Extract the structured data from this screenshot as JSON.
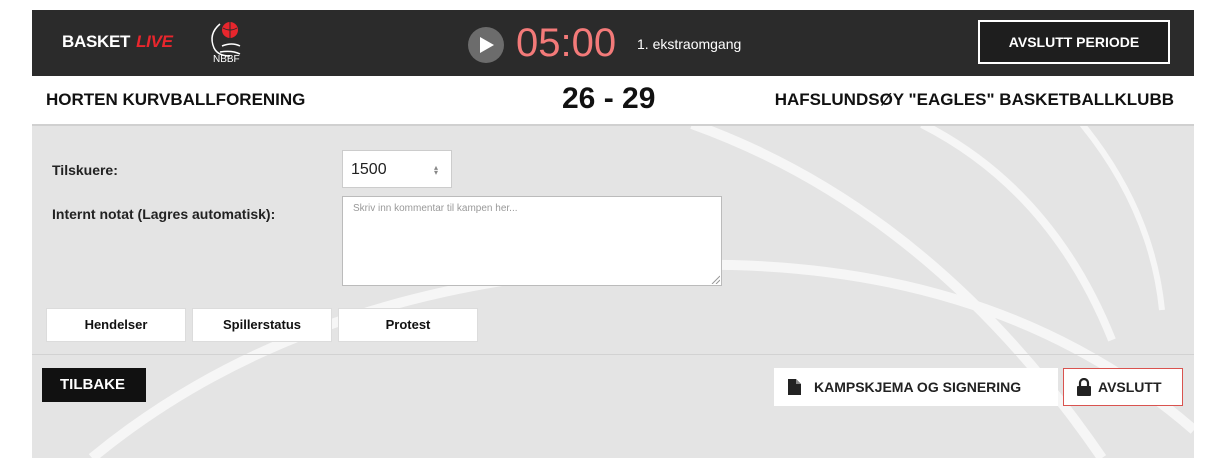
{
  "header": {
    "brand": "BASKET",
    "brand_accent": "LIVE",
    "federation_logo_text": "NBBF",
    "clock": "05:00",
    "period": "1. ekstraomgang",
    "end_period_label": "AVSLUTT PERIODE"
  },
  "match": {
    "home_team": "HORTEN KURVBALLFORENING",
    "score": "26 - 29",
    "away_team": "HAFSLUNDSØY \"EAGLES\" BASKETBALLKLUBB"
  },
  "form": {
    "spectators_label": "Tilskuere:",
    "spectators_value": "1500",
    "note_label": "Internt notat (Lagres automatisk):",
    "note_placeholder": "Skriv inn kommentar til kampen her..."
  },
  "tabs": [
    {
      "label": "Hendelser"
    },
    {
      "label": "Spillerstatus"
    },
    {
      "label": "Protest"
    }
  ],
  "footer": {
    "back_label": "TILBAKE",
    "match_form_label": "KAMPSKJEMA OG SIGNERING",
    "finish_label": "AVSLUTT"
  },
  "colors": {
    "topbar": "#2b2b2b",
    "clock": "#f37a79",
    "accent_red": "#e8262d",
    "background": "#e4e4e4"
  },
  "icons": {
    "play": "play-icon",
    "document": "document-icon",
    "lock": "lock-icon",
    "spinner": "number-spinner-icon"
  }
}
